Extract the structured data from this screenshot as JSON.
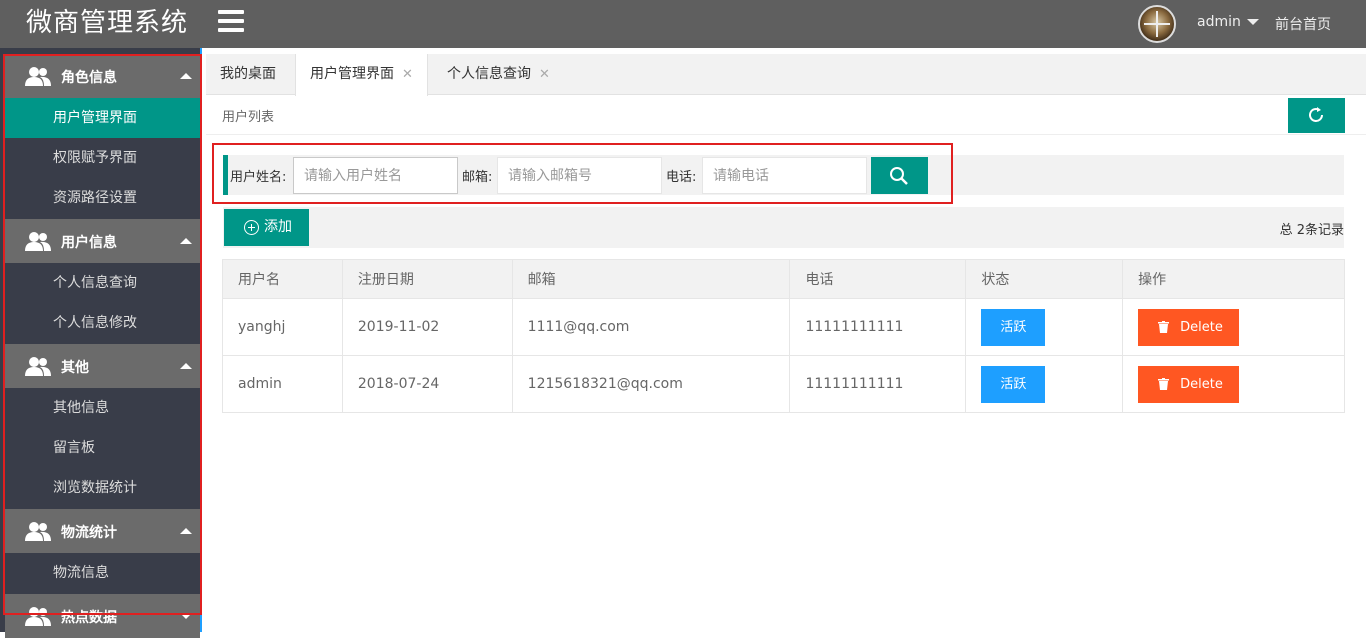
{
  "app": {
    "title": "微商管理系统"
  },
  "header": {
    "user": "admin",
    "front_link": "前台首页"
  },
  "sidebar": {
    "groups": [
      {
        "label": "角色信息",
        "items": [
          "用户管理界面",
          "权限赋予界面",
          "资源路径设置"
        ]
      },
      {
        "label": "用户信息",
        "items": [
          "个人信息查询",
          "个人信息修改"
        ]
      },
      {
        "label": "其他",
        "items": [
          "其他信息",
          "留言板",
          "浏览数据统计"
        ]
      },
      {
        "label": "物流统计",
        "items": [
          "物流信息"
        ]
      },
      {
        "label": "热点数据",
        "items": []
      }
    ],
    "active_item": "用户管理界面"
  },
  "tabs": [
    "我的桌面",
    "用户管理界面",
    "个人信息查询"
  ],
  "breadcrumb": "用户列表",
  "search": {
    "username_label": "用户姓名:",
    "username_placeholder": "请输入用户姓名",
    "email_label": "邮箱:",
    "email_placeholder": "请输入邮箱号",
    "phone_label": "电话:",
    "phone_placeholder": "请输电话"
  },
  "actions": {
    "add_label": "添加",
    "total": "总 2条记录"
  },
  "table": {
    "headers": [
      "用户名",
      "注册日期",
      "邮箱",
      "电话",
      "状态",
      "操作"
    ],
    "rows": [
      {
        "username": "yanghj",
        "date": "2019-11-02",
        "email": "1111@qq.com",
        "phone": "11111111111",
        "status": "活跃",
        "action": "Delete"
      },
      {
        "username": "admin",
        "date": "2018-07-24",
        "email": "1215618321@qq.com",
        "phone": "11111111111",
        "status": "活跃",
        "action": "Delete"
      }
    ]
  },
  "colors": {
    "accent": "#009688",
    "header": "#5f5f5f",
    "sidebar": "#393d49",
    "group": "#6b6b6b",
    "status": "#1e9fff",
    "danger": "#ff5722"
  }
}
